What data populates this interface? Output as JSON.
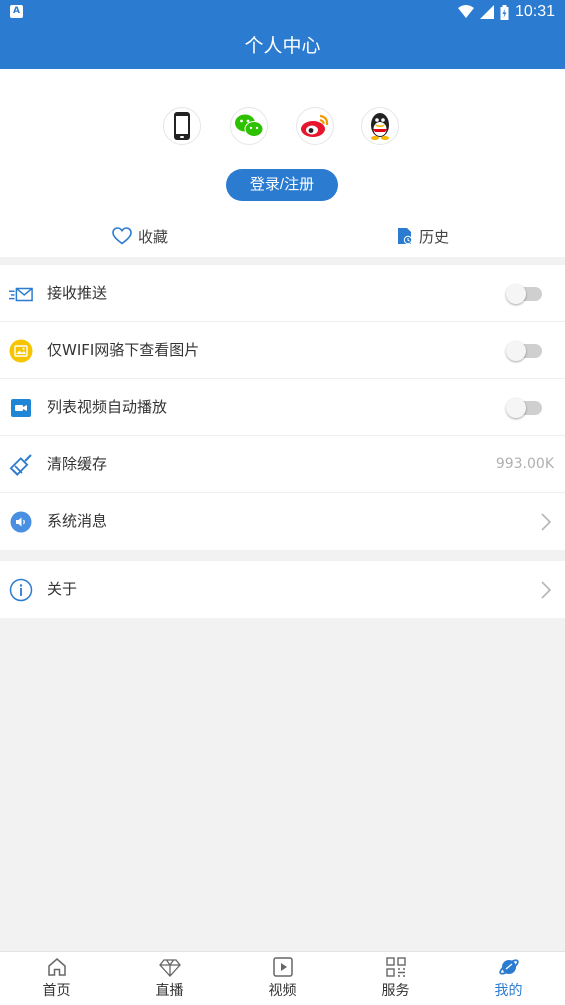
{
  "status_bar": {
    "badge": "A",
    "time": "10:31"
  },
  "header": {
    "title": "个人中心"
  },
  "profile": {
    "social_icons": [
      "phone-icon",
      "wechat-icon",
      "weibo-icon",
      "qq-icon"
    ],
    "login_label": "登录/注册",
    "favorites_label": "收藏",
    "history_label": "历史"
  },
  "settings": {
    "push_label": "接收推送",
    "push_on": false,
    "wifi_label": "仅WIFI网骆下查看图片",
    "wifi_on": false,
    "autoplay_label": "列表视频自动播放",
    "autoplay_on": false,
    "cache_label": "清除缓存",
    "cache_value": "993.00K",
    "messages_label": "系统消息"
  },
  "about": {
    "label": "关于"
  },
  "tabbar": {
    "items": [
      {
        "label": "首页",
        "icon": "home-icon"
      },
      {
        "label": "直播",
        "icon": "diamond-icon"
      },
      {
        "label": "视频",
        "icon": "play-icon"
      },
      {
        "label": "服务",
        "icon": "grid-icon"
      },
      {
        "label": "我的",
        "icon": "planet-icon"
      }
    ],
    "active_index": 4
  },
  "colors": {
    "primary": "#2b7bd0",
    "background": "#f2f2f2",
    "toggle_off": "#cfcfcf",
    "muted_text": "#b0b0b0"
  }
}
